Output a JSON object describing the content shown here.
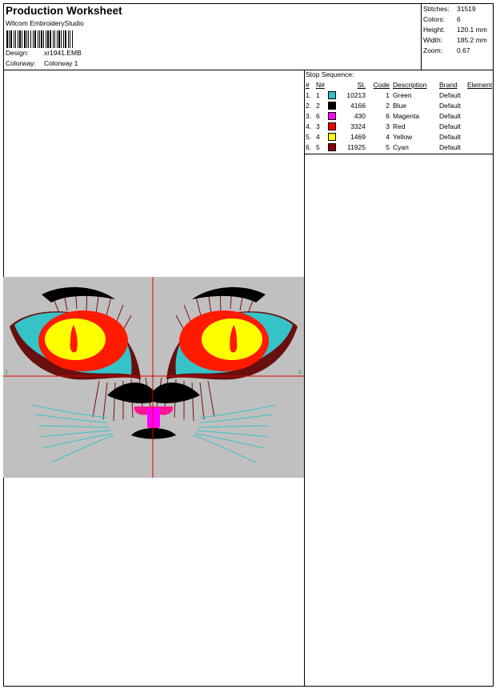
{
  "header": {
    "title": "Production Worksheet",
    "subtitle": "Wilcom EmbroideryStudio",
    "design_label": "Design:",
    "design_value": "xr1941.EMB",
    "colorway_label": "Colorway:",
    "colorway_value": "Colorway 1"
  },
  "stats": {
    "stitches_label": "Stitches:",
    "stitches_value": "31519",
    "colors_label": "Colors:",
    "colors_value": "6",
    "height_label": "Height:",
    "height_value": "120.1 mm",
    "width_label": "Width:",
    "width_value": "185.2 mm",
    "zoom_label": "Zoom:",
    "zoom_value": "0.67"
  },
  "stop_sequence": {
    "title": "Stop Sequence:",
    "columns": [
      "#",
      "N#",
      "St.",
      "Code",
      "Description",
      "Brand",
      "Element"
    ],
    "rows": [
      {
        "idx": "1.",
        "n": "1",
        "color": "#33c0c8",
        "st": "10213",
        "code": "1",
        "desc": "Green",
        "brand": "Default",
        "element": ""
      },
      {
        "idx": "2.",
        "n": "2",
        "color": "#000000",
        "st": "4166",
        "code": "2",
        "desc": "Blue",
        "brand": "Default",
        "element": ""
      },
      {
        "idx": "3.",
        "n": "6",
        "color": "#ff00ff",
        "st": "430",
        "code": "6",
        "desc": "Magenta",
        "brand": "Default",
        "element": ""
      },
      {
        "idx": "4.",
        "n": "3",
        "color": "#ff0000",
        "st": "3324",
        "code": "3",
        "desc": "Red",
        "brand": "Default",
        "element": ""
      },
      {
        "idx": "5.",
        "n": "4",
        "color": "#ffff00",
        "st": "1469",
        "code": "4",
        "desc": "Yellow",
        "brand": "Default",
        "element": ""
      },
      {
        "idx": "6.",
        "n": "5",
        "color": "#8b0000",
        "st": "11925",
        "code": "5",
        "desc": "Cyan",
        "brand": "Default",
        "element": ""
      }
    ]
  },
  "design_preview": {
    "axis_left_label": "1",
    "axis_right_label": "2",
    "background_color": "#c0c0c0",
    "crosshair_color": "#e00000"
  }
}
